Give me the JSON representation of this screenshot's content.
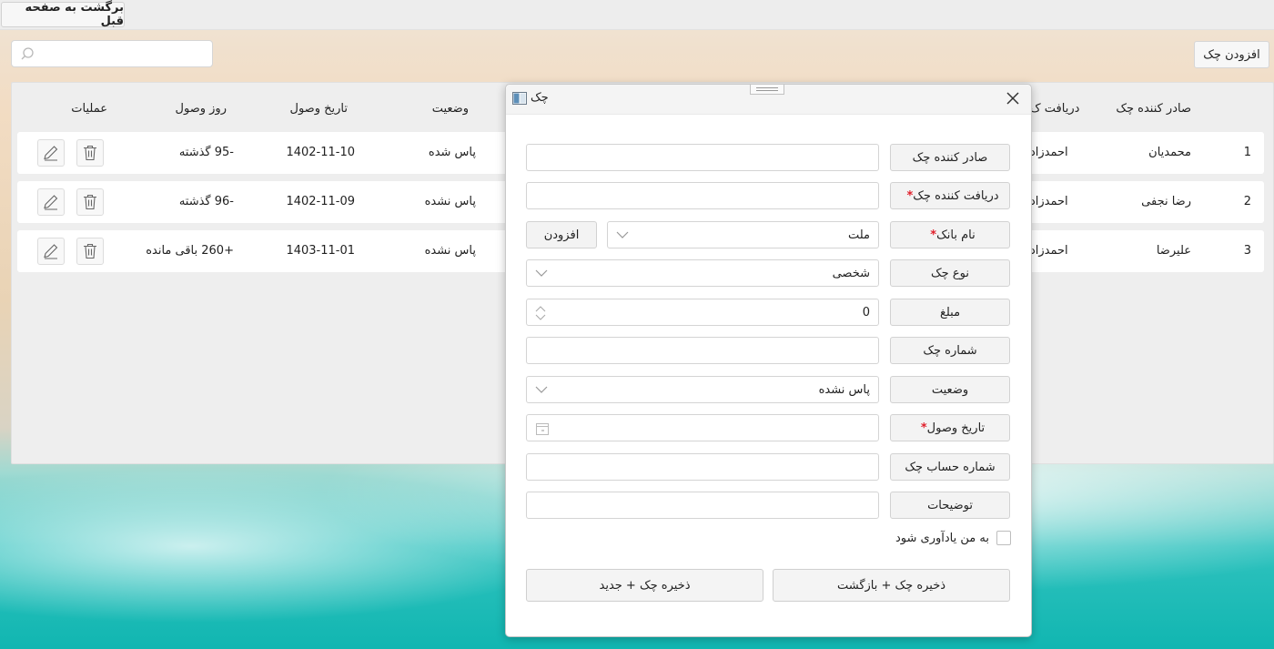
{
  "topbar": {
    "back_label": "برگشت به صفحه قبل"
  },
  "toolbar": {
    "add_check_label": "افزودن چک",
    "search_placeholder": ""
  },
  "table": {
    "headers": {
      "issuer": "صادر کننده چک",
      "receiver": "دریافت ک",
      "status": "وضعیت",
      "receipt_date": "تاریخ وصول",
      "days": "روز وصول",
      "operations": "عملیات"
    },
    "rows": [
      {
        "index": "1",
        "issuer": "محمدیان",
        "receiver": "احمدزاد",
        "status": "پاس شده",
        "receipt_date": "1402-11-10",
        "days": "-95 گذشته"
      },
      {
        "index": "2",
        "issuer": "رضا نجفی",
        "receiver": "احمدزاد",
        "status": "پاس نشده",
        "receipt_date": "1402-11-09",
        "days": "-96 گذشته"
      },
      {
        "index": "3",
        "issuer": "علیرضا",
        "receiver": "احمدزاد",
        "status": "پاس نشده",
        "receipt_date": "1403-11-01",
        "days": "+260 باقی مانده"
      }
    ]
  },
  "dialog": {
    "title": "چک",
    "fields": {
      "issuer_label": "صادر کننده چک",
      "issuer_value": "",
      "receiver_label": "دریافت کننده چک",
      "bank_label": "نام بانک",
      "bank_value": "ملت",
      "bank_add_label": "افزودن",
      "type_label": "نوع چک",
      "type_value": "شخصی",
      "amount_label": "مبلغ",
      "amount_value": "0",
      "number_label": "شماره چک",
      "status_label": "وضعیت",
      "status_value": "پاس نشده",
      "date_label": "تاریخ وصول",
      "account_label": "شماره حساب چک",
      "notes_label": "توضیحات",
      "required_mark": "*"
    },
    "remind_label": "به من یادآوری شود",
    "save_back_label": "ذخیره چک + بازگشت",
    "save_new_label": "ذخیره چک + جدید"
  },
  "colors": {
    "required": "#e0202c",
    "panel": "#eeeeee",
    "button": "#f3f3f3"
  }
}
